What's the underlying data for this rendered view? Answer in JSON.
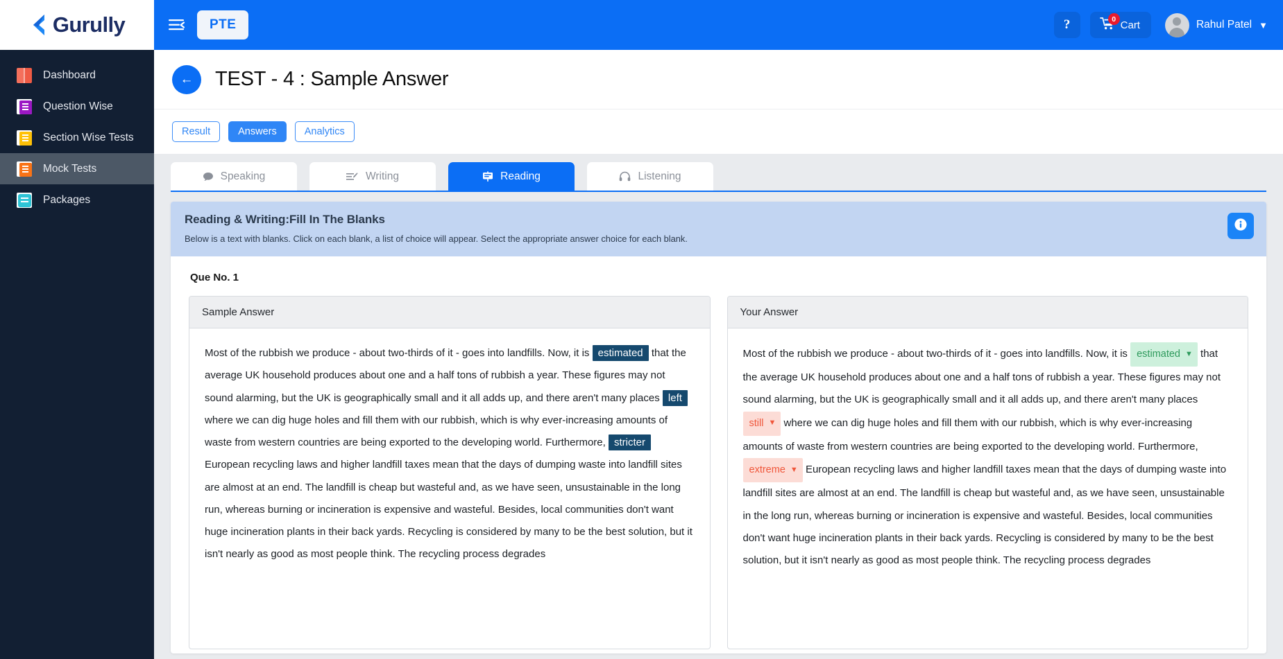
{
  "brand": {
    "name": "Gurully",
    "mark_icon": "chevron-left-logo-icon"
  },
  "sidebar": {
    "items": [
      {
        "label": "Dashboard",
        "icon": "book-icon",
        "active": false
      },
      {
        "label": "Question Wise",
        "icon": "question-list-icon",
        "active": false
      },
      {
        "label": "Section Wise Tests",
        "icon": "section-notes-icon",
        "active": false
      },
      {
        "label": "Mock Tests",
        "icon": "mock-test-icon",
        "active": true
      },
      {
        "label": "Packages",
        "icon": "package-icon",
        "active": false
      }
    ]
  },
  "topbar": {
    "menu_toggle_icon": "hamburger-menu-icon",
    "product_label": "PTE",
    "help_icon": "question-mark-icon",
    "cart_label": "Cart",
    "cart_icon": "shopping-cart-icon",
    "cart_count": "0",
    "user_name": "Rahul Patel",
    "user_chevron_icon": "chevron-down-icon",
    "avatar_icon": "user-avatar-icon"
  },
  "page": {
    "back_icon": "arrow-left-icon",
    "title": "TEST - 4 : Sample Answer"
  },
  "view_pills": [
    {
      "label": "Result",
      "active": false
    },
    {
      "label": "Answers",
      "active": true
    },
    {
      "label": "Analytics",
      "active": false
    }
  ],
  "section_tabs": [
    {
      "label": "Speaking",
      "icon": "speech-bubble-icon",
      "active": false
    },
    {
      "label": "Writing",
      "icon": "pencil-lines-icon",
      "active": false
    },
    {
      "label": "Reading",
      "icon": "board-icon",
      "active": true
    },
    {
      "label": "Listening",
      "icon": "headphones-icon",
      "active": false
    }
  ],
  "question": {
    "banner_title": "Reading & Writing:Fill In The Blanks",
    "banner_subtitle": "Below is a text with blanks. Click on each blank, a list of choice will appear. Select the appropriate answer choice for each blank.",
    "info_icon": "info-circle-icon",
    "number_label": "Que No. 1"
  },
  "sample_answer": {
    "heading": "Sample Answer",
    "segments": [
      {
        "type": "text",
        "value": "Most of the rubbish we produce - about two-thirds of it - goes into landfills. Now, it is "
      },
      {
        "type": "chip",
        "value": "estimated"
      },
      {
        "type": "text",
        "value": " that the average UK household produces about one and a half tons of rubbish a year. These figures may not sound alarming, but the UK is geographically small and it all adds up, and there aren't many places "
      },
      {
        "type": "chip",
        "value": "left"
      },
      {
        "type": "text",
        "value": " where we can dig huge holes and fill them with our rubbish, which is why ever-increasing amounts of waste from western countries are being exported to the developing world. Furthermore, "
      },
      {
        "type": "chip",
        "value": "stricter"
      },
      {
        "type": "text",
        "value": " European recycling laws and higher landfill taxes mean that the days of dumping waste into landfill sites are almost at an end. The landfill is cheap but wasteful and, as we have seen, unsustainable in the long run, whereas burning or incineration is expensive and wasteful. Besides, local communities don't want huge incineration plants in their back yards. Recycling is considered by many to be the best solution, but it isn't nearly as good as most people think. The recycling process degrades"
      }
    ]
  },
  "your_answer": {
    "heading": "Your Answer",
    "segments": [
      {
        "type": "text",
        "value": "Most of the rubbish we produce - about two-thirds of it - goes into landfills. Now, it is "
      },
      {
        "type": "select",
        "value": "estimated",
        "state": "correct"
      },
      {
        "type": "text",
        "value": " that the average UK household produces about one and a half tons of rubbish a year. These figures may not sound alarming, but the UK is geographically small and it all adds up, and there aren't many places "
      },
      {
        "type": "select",
        "value": "still",
        "state": "incorrect"
      },
      {
        "type": "text",
        "value": " where we can dig huge holes and fill them with our rubbish, which is why ever-increasing amounts of waste from western countries are being exported to the developing world. Furthermore, "
      },
      {
        "type": "select",
        "value": "extreme",
        "state": "incorrect"
      },
      {
        "type": "text",
        "value": " European recycling laws and higher landfill taxes mean that the days of dumping waste into landfill sites are almost at an end. The landfill is cheap but wasteful and, as we have seen, unsustainable in the long run, whereas burning or incineration is expensive and wasteful. Besides, local communities don't want huge incineration plants in their back yards. Recycling is considered by many to be the best solution, but it isn't nearly as good as most people think. The recycling process degrades"
      }
    ]
  },
  "colors": {
    "brand_blue": "#0b6ef5",
    "sidebar_bg": "#121f33",
    "sidebar_active": "#4c5866",
    "banner_bg": "#c2d5f2",
    "chip_correct_bg": "#15496e",
    "select_correct_bg": "#cdf0dc",
    "select_correct_fg": "#2e9a5c",
    "select_incorrect_bg": "#fcdcd6",
    "select_incorrect_fg": "#f0563a"
  }
}
